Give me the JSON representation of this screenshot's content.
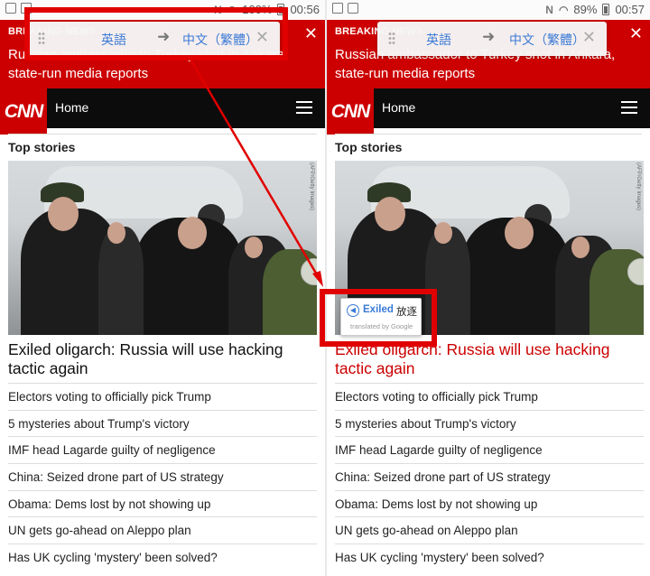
{
  "left_screen": {
    "status_time": "00:56",
    "status_battery": "100%"
  },
  "right_screen": {
    "status_time": "00:57",
    "status_battery": "89%"
  },
  "breaking": {
    "label": "BREAKING NEWS",
    "headline": "Russian ambassador to Turkey shot in Ankara, state-run media reports",
    "close": "✕"
  },
  "translate_bar": {
    "source_lang": "英語",
    "arrow": "➜",
    "target_lang": "中文（繁體）",
    "close": "✕"
  },
  "cnn": {
    "logo": "CNN",
    "nav_home": "Home"
  },
  "section_title": "Top stories",
  "photo_credit": "(AFP/Getty Images)",
  "headline": "Exiled oligarch: Russia will use hacking tactic again",
  "stories": [
    "Electors voting to officially pick Trump",
    "5 mysteries about Trump's victory",
    "IMF head Lagarde guilty of negligence",
    "China: Seized drone part of US strategy",
    "Obama: Dems lost by not showing up",
    "UN gets go-ahead on Aleppo plan",
    "Has UK cycling 'mystery' been solved?"
  ],
  "popup": {
    "word": "Exiled",
    "translation": "放逐",
    "credit": "translated by Google"
  },
  "colors": {
    "cnn_red": "#cc0000",
    "link_blue": "#3a7ad6",
    "annotation_red": "#e00000"
  }
}
